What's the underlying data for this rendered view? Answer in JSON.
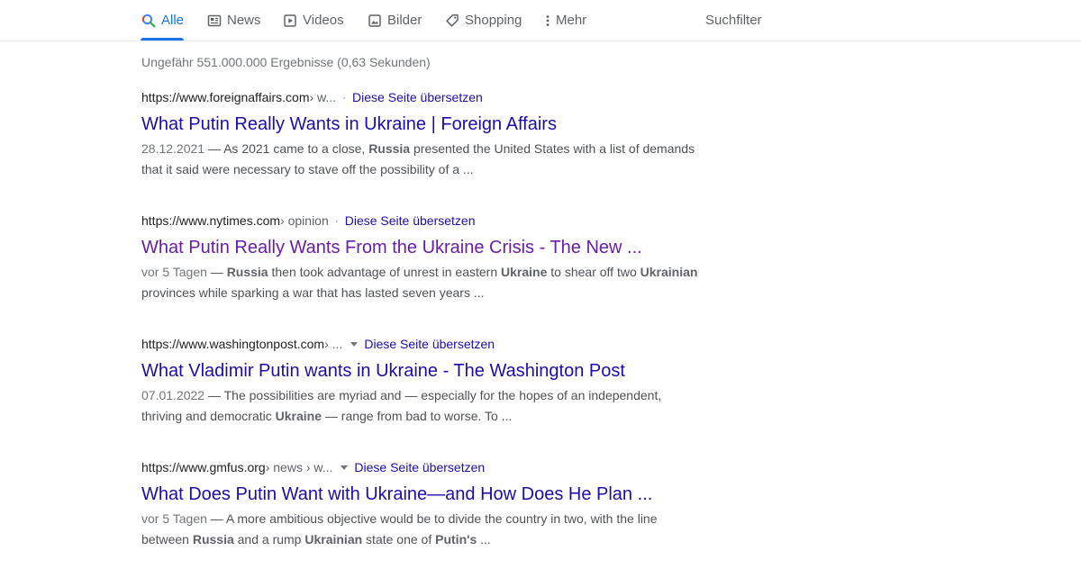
{
  "tabs": [
    {
      "label": "Alle",
      "icon": "search-icon",
      "active": true
    },
    {
      "label": "News",
      "icon": "newspaper-icon",
      "active": false
    },
    {
      "label": "Videos",
      "icon": "play-icon",
      "active": false
    },
    {
      "label": "Bilder",
      "icon": "image-icon",
      "active": false
    },
    {
      "label": "Shopping",
      "icon": "tag-icon",
      "active": false
    },
    {
      "label": "Mehr",
      "icon": "more-vert-icon",
      "active": false
    }
  ],
  "filter_label": "Suchfilter",
  "stats": "Ungefähr 551.000.000 Ergebnisse (0,63 Sekunden)",
  "colors": {
    "link": "#1a0dab",
    "visited": "#681da8",
    "active_tab": "#1a73e8"
  },
  "results": [
    {
      "url": "https://www.foreignaffairs.com",
      "path": " › w...",
      "translate": "Diese Seite übersetzen",
      "title": "What Putin Really Wants in Ukraine | Foreign Affairs",
      "date": "28.12.2021",
      "snippet_parts": [
        {
          "t": " — As 2021 came to a close, ",
          "b": false
        },
        {
          "t": "Russia",
          "b": true
        },
        {
          "t": " presented the United States with a list of demands that it said were necessary to stave off the possibility of a ...",
          "b": false
        }
      ]
    },
    {
      "url": "https://www.nytimes.com",
      "path": " › opinion",
      "translate": "Diese Seite übersetzen",
      "title": "What Putin Really Wants From the Ukraine Crisis - The New ...",
      "date": "vor 5 Tagen",
      "snippet_parts": [
        {
          "t": " — ",
          "b": false
        },
        {
          "t": "Russia",
          "b": true
        },
        {
          "t": " then took advantage of unrest in eastern ",
          "b": false
        },
        {
          "t": "Ukraine",
          "b": true
        },
        {
          "t": " to shear off two ",
          "b": false
        },
        {
          "t": "Ukrainian",
          "b": true
        },
        {
          "t": " provinces while sparking a war that has lasted seven years ...",
          "b": false
        }
      ]
    },
    {
      "url": "https://www.washingtonpost.com",
      "path": " › ...",
      "translate": "Diese Seite übersetzen",
      "title": "What Vladimir Putin wants in Ukraine - The Washington Post",
      "date": "07.01.2022",
      "snippet_parts": [
        {
          "t": " — The possibilities are myriad and — especially for the hopes of an independent, thriving and democratic ",
          "b": false
        },
        {
          "t": "Ukraine",
          "b": true
        },
        {
          "t": " — range from bad to worse. To ...",
          "b": false
        }
      ]
    },
    {
      "url": "https://www.gmfus.org",
      "path": " › news › w...",
      "translate": "Diese Seite übersetzen",
      "title": "What Does Putin Want with Ukraine—and How Does He Plan ...",
      "date": "vor 5 Tagen",
      "snippet_parts": [
        {
          "t": " — A more ambitious objective would be to divide the country in two, with the line between ",
          "b": false
        },
        {
          "t": "Russia",
          "b": true
        },
        {
          "t": " and a rump ",
          "b": false
        },
        {
          "t": "Ukrainian",
          "b": true
        },
        {
          "t": " state one of ",
          "b": false
        },
        {
          "t": "Putin's",
          "b": true
        },
        {
          "t": " ...",
          "b": false
        }
      ]
    }
  ]
}
